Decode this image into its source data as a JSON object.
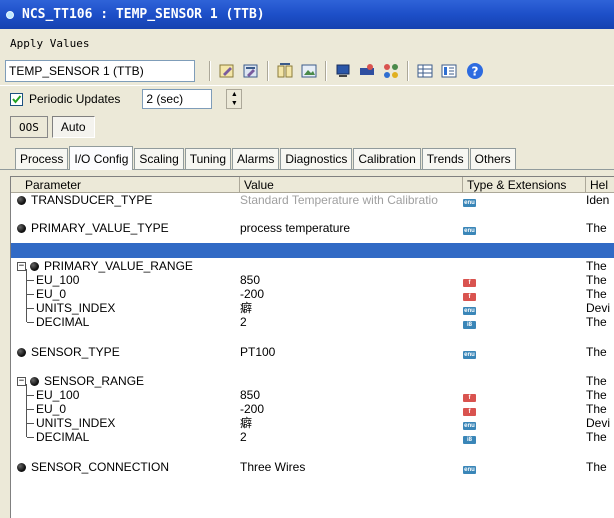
{
  "window": {
    "title": "NCS_TT106 : TEMP_SENSOR 1 (TTB)"
  },
  "menu": {
    "apply_values": "Apply Values"
  },
  "toolbar": {
    "block_select_value": "TEMP_SENSOR 1 (TTB)",
    "icons": [
      "edit-icon",
      "edit-all-icon",
      "compare-icon",
      "picture-icon",
      "monitor-icon",
      "transfer-icon",
      "network-icon",
      "table-icon",
      "list-icon",
      "help-icon"
    ]
  },
  "periodic": {
    "label": "Periodic Updates",
    "checked": true,
    "interval_value": "2 (sec)"
  },
  "modes": {
    "oos": "OOS",
    "auto": "Auto"
  },
  "tabs": [
    "Process",
    "I/O Config",
    "Scaling",
    "Tuning",
    "Alarms",
    "Diagnostics",
    "Calibration",
    "Trends",
    "Others"
  ],
  "active_tab": "I/O Config",
  "grid": {
    "headers": {
      "parameter": "Parameter",
      "value": "Value",
      "type": "Type & Extensions",
      "help": "Hel"
    },
    "rows": [
      {
        "param": "TRANSDUCER_TYPE",
        "value": "Standard Temperature with Calibratio",
        "type": "enu",
        "help": "Iden",
        "muted": true
      },
      {
        "param": "PRIMARY_VALUE_TYPE",
        "value": "process temperature",
        "type": "enu",
        "help": "The"
      },
      {
        "param": "",
        "value": "",
        "type": "",
        "help": "",
        "selected": true
      },
      {
        "param": "PRIMARY_VALUE_RANGE",
        "value": "",
        "type": "",
        "help": "The",
        "group": true
      },
      {
        "param": "EU_100",
        "value": "850",
        "type": "flt",
        "help": "The",
        "child": true
      },
      {
        "param": "EU_0",
        "value": "-200",
        "type": "flt",
        "help": "The",
        "child": true
      },
      {
        "param": "UNITS_INDEX",
        "value": "癖",
        "type": "enu",
        "help": "Devi",
        "child": true
      },
      {
        "param": "DECIMAL",
        "value": "2",
        "type": "i8",
        "help": "The",
        "child": true
      },
      {
        "param": "SENSOR_TYPE",
        "value": "PT100",
        "type": "enu",
        "help": "The"
      },
      {
        "param": "SENSOR_RANGE",
        "value": "",
        "type": "",
        "help": "The",
        "group": true
      },
      {
        "param": "EU_100",
        "value": "850",
        "type": "flt",
        "help": "The",
        "child": true
      },
      {
        "param": "EU_0",
        "value": "-200",
        "type": "flt",
        "help": "The",
        "child": true
      },
      {
        "param": "UNITS_INDEX",
        "value": "癖",
        "type": "enu",
        "help": "Devi",
        "child": true
      },
      {
        "param": "DECIMAL",
        "value": "2",
        "type": "i8",
        "help": "The",
        "child": true
      },
      {
        "param": "SENSOR_CONNECTION",
        "value": "Three Wires",
        "type": "enu",
        "help": "The"
      }
    ]
  },
  "type_icon_labels": {
    "enu": "enu",
    "flt": "f",
    "i8": "i8"
  },
  "colors": {
    "title_bar": "#1d4fc8",
    "selection": "#316ac5",
    "float_icon": "#d9534f",
    "enum_icon": "#3a86b8"
  }
}
